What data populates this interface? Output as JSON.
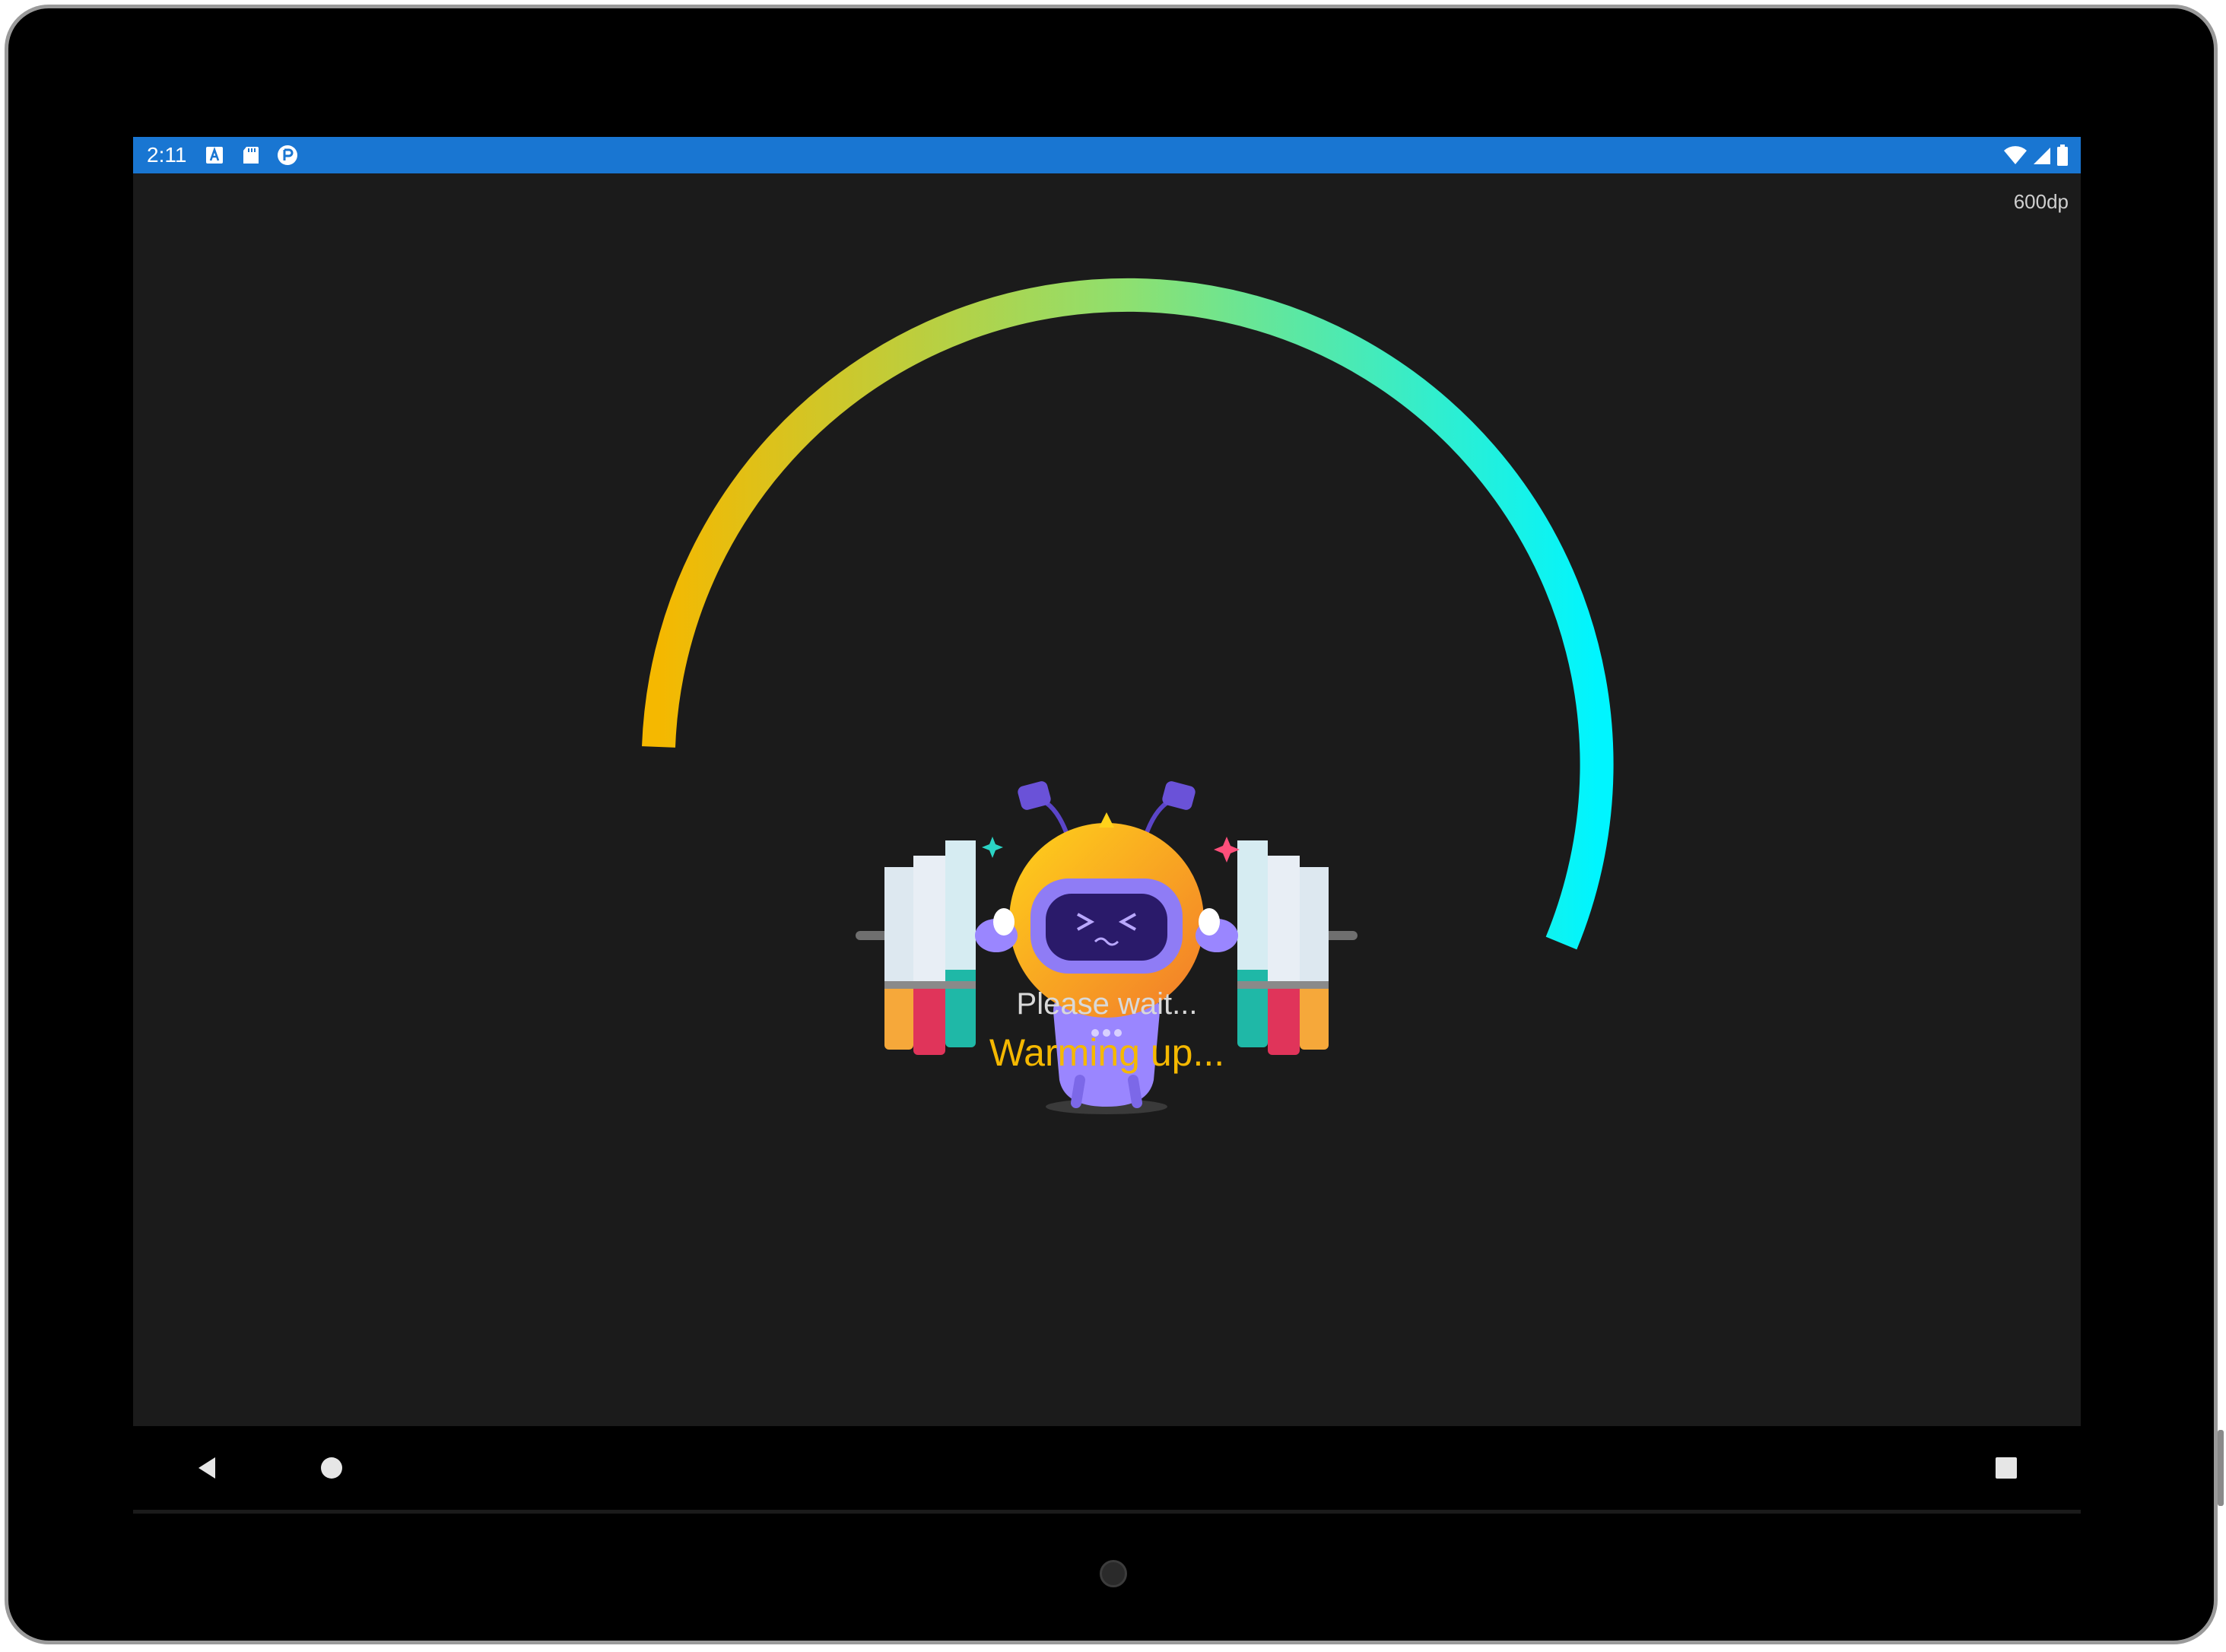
{
  "status_bar": {
    "time": "2:11",
    "left_icons": [
      "a-notification-icon",
      "sd-card-icon",
      "app-notification-icon"
    ],
    "right_icons": [
      "wifi-icon",
      "cellular-signal-icon",
      "battery-icon"
    ],
    "color": "#1976d2"
  },
  "screen": {
    "dp_label": "600dp",
    "background": "#1b1b1b"
  },
  "loading": {
    "wait_text": "Please wait...",
    "status_text": "Warming up...",
    "status_color": "#f5b800",
    "progress_gradient": [
      "#f5b800",
      "#8ee070",
      "#00f5ff"
    ]
  },
  "mascot": {
    "description_icon": "robot-lifting-books-icon"
  },
  "nav_bar": {
    "buttons": [
      "back-icon",
      "home-icon",
      "recents-icon"
    ]
  }
}
